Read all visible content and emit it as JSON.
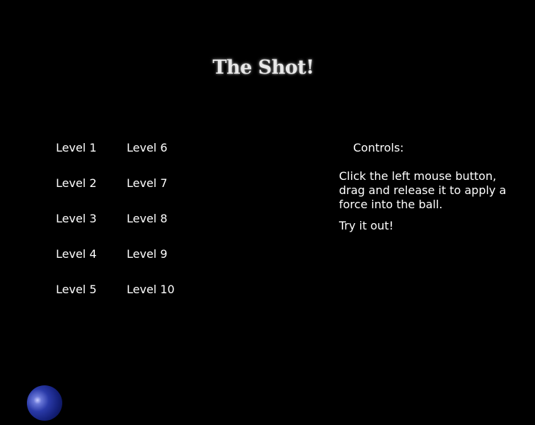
{
  "title": "The Shot!",
  "levels": [
    {
      "label": "Level 1"
    },
    {
      "label": "Level 2"
    },
    {
      "label": "Level 3"
    },
    {
      "label": "Level 4"
    },
    {
      "label": "Level 5"
    },
    {
      "label": "Level 6"
    },
    {
      "label": "Level 7"
    },
    {
      "label": "Level 8"
    },
    {
      "label": "Level 9"
    },
    {
      "label": "Level 10"
    }
  ],
  "controls": {
    "heading": "Controls:",
    "description": "Click the left mouse button, drag and release it to apply a force into the ball.",
    "try_it": "Try it out!"
  },
  "colors": {
    "background": "#000000",
    "text": "#ffffff",
    "ball": "#2a3aa8"
  }
}
